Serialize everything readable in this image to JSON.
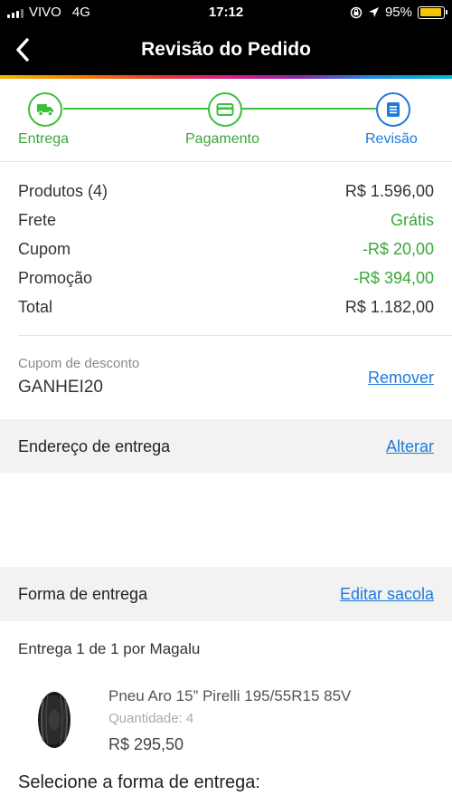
{
  "status_bar": {
    "carrier": "VIVO",
    "network": "4G",
    "time": "17:12",
    "battery": "95%",
    "battery_level": 0.95
  },
  "nav": {
    "title": "Revisão do Pedido",
    "back_icon": "chevron-left-icon"
  },
  "stepper": {
    "steps": [
      {
        "label": "Entrega",
        "icon": "truck-icon",
        "color": "#3ac13a"
      },
      {
        "label": "Pagamento",
        "icon": "credit-card-icon",
        "color": "#3ac13a"
      },
      {
        "label": "Revisão",
        "icon": "document-icon",
        "color": "#1f7ad8"
      }
    ]
  },
  "summary": {
    "rows": [
      {
        "label": "Produtos (4)",
        "value": "R$ 1.596,00"
      },
      {
        "label": "Frete",
        "value": "Grátis"
      },
      {
        "label": "Cupom",
        "value": "-R$ 20,00"
      },
      {
        "label": "Promoção",
        "value": "-R$ 394,00"
      },
      {
        "label": "Total",
        "value": "R$ 1.182,00"
      }
    ]
  },
  "coupon": {
    "label": "Cupom de desconto",
    "code": "GANHEI20",
    "remove_label": "Remover"
  },
  "address": {
    "title": "Endereço de entrega",
    "change_label": "Alterar"
  },
  "shipping": {
    "title": "Forma de entrega",
    "edit_label": "Editar sacola",
    "delivery_prefix": "Entrega 1 de 1",
    "delivery_suffix": "por Magalu"
  },
  "product": {
    "name": "Pneu Aro 15” Pirelli 195/55R15 85V",
    "quantity": "Quantidade: 4",
    "price": "R$ 295,50",
    "icon": "tire-icon"
  },
  "select_title": "Selecione a forma de entrega:",
  "colors": {
    "green": "#3ac13a",
    "blue": "#1f7ad8"
  }
}
